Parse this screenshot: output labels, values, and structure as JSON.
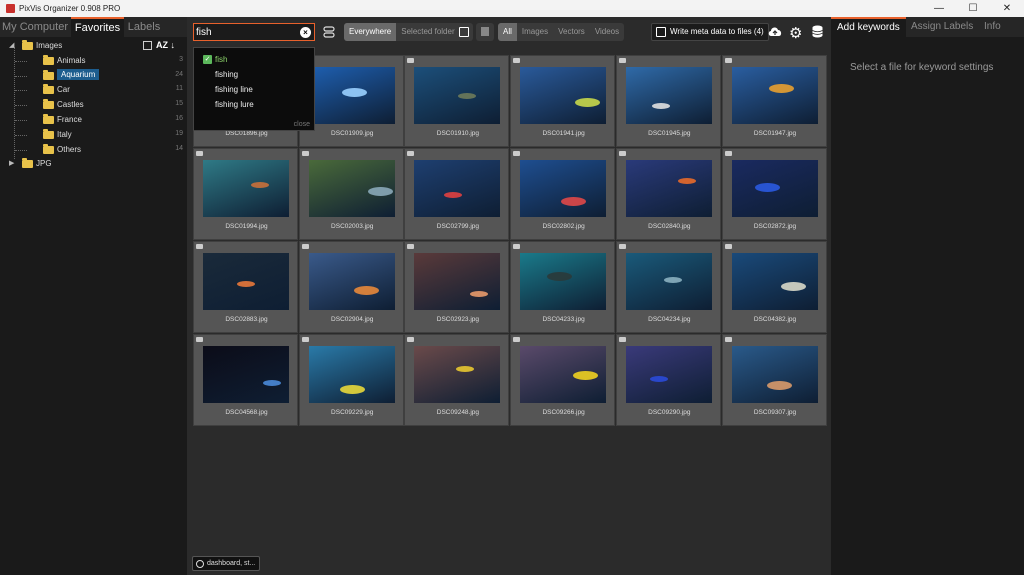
{
  "window": {
    "title": "PixVis Organizer 0.908 PRO",
    "minimize_glyph": "—",
    "maximize_glyph": "☐",
    "close_glyph": "✕"
  },
  "sidebar": {
    "tabs": [
      {
        "label": "My Computer",
        "active": false
      },
      {
        "label": "Favorites",
        "active": true
      },
      {
        "label": "Labels",
        "active": false
      }
    ],
    "sort_label": "AZ ↓",
    "tree": [
      {
        "label": "Images",
        "count": "",
        "expanded": true,
        "level": 0,
        "selected": false
      },
      {
        "label": "Animals",
        "count": "3",
        "level": 1,
        "selected": false
      },
      {
        "label": "Aquarium",
        "count": "24",
        "level": 1,
        "selected": true
      },
      {
        "label": "Car",
        "count": "11",
        "level": 1,
        "selected": false
      },
      {
        "label": "Castles",
        "count": "15",
        "level": 1,
        "selected": false
      },
      {
        "label": "France",
        "count": "16",
        "level": 1,
        "selected": false
      },
      {
        "label": "Italy",
        "count": "19",
        "level": 1,
        "selected": false
      },
      {
        "label": "Others",
        "count": "14",
        "level": 1,
        "selected": false
      },
      {
        "label": "JPG",
        "count": "",
        "expanded": false,
        "level": 0,
        "selected": false
      }
    ]
  },
  "toolbar": {
    "search_value": "fish",
    "scope_options": [
      {
        "label": "Everywhere",
        "active": true
      },
      {
        "label": "Selected folder",
        "active": false
      }
    ],
    "type_options": [
      {
        "label": "All",
        "active": true
      },
      {
        "label": "Images",
        "active": false
      },
      {
        "label": "Vectors",
        "active": false
      },
      {
        "label": "Videos",
        "active": false
      }
    ],
    "write_button_label": "Write meta data to files",
    "write_count": "(4)"
  },
  "suggestions": {
    "items": [
      {
        "label": "fish",
        "checked": true
      },
      {
        "label": "fishing",
        "checked": false
      },
      {
        "label": "fishing line",
        "checked": false
      },
      {
        "label": "fishing lure",
        "checked": false
      }
    ],
    "close_label": "close"
  },
  "files": [
    {
      "name": "DSC01896.jpg",
      "bg": "#2a4a7a",
      "accent": "#8ab8e8"
    },
    {
      "name": "DSC01909.jpg",
      "bg": "#1e5fb0",
      "accent": "#9ad0ff"
    },
    {
      "name": "DSC01910.jpg",
      "bg": "#1c4f7a",
      "accent": "#6d7a5a"
    },
    {
      "name": "DSC01941.jpg",
      "bg": "#2a5a9a",
      "accent": "#c8d84a"
    },
    {
      "name": "DSC01945.jpg",
      "bg": "#2f6aa8",
      "accent": "#e0e0e0"
    },
    {
      "name": "DSC01947.jpg",
      "bg": "#2a5ea0",
      "accent": "#e8a030"
    },
    {
      "name": "DSC01994.jpg",
      "bg": "#2f7a86",
      "accent": "#c8703a"
    },
    {
      "name": "DSC02003.jpg",
      "bg": "#4a6a3a",
      "accent": "#8aa8b8"
    },
    {
      "name": "DSC02799.jpg",
      "bg": "#1e3f70",
      "accent": "#e04040"
    },
    {
      "name": "DSC02802.jpg",
      "bg": "#1e4e90",
      "accent": "#e04848"
    },
    {
      "name": "DSC02840.jpg",
      "bg": "#2a3a7a",
      "accent": "#e86a2a"
    },
    {
      "name": "DSC02872.jpg",
      "bg": "#1a2a60",
      "accent": "#2a5ae0"
    },
    {
      "name": "DSC02883.jpg",
      "bg": "#1a2a3a",
      "accent": "#e8783a"
    },
    {
      "name": "DSC02904.jpg",
      "bg": "#3a5a8a",
      "accent": "#e8883a"
    },
    {
      "name": "DSC02923.jpg",
      "bg": "#5a3a3a",
      "accent": "#e89a6a"
    },
    {
      "name": "DSC04233.jpg",
      "bg": "#1a7a8a",
      "accent": "#2a3a3a"
    },
    {
      "name": "DSC04234.jpg",
      "bg": "#1a5a7a",
      "accent": "#8ab0c0"
    },
    {
      "name": "DSC04382.jpg",
      "bg": "#1a4a7a",
      "accent": "#d8d8c8"
    },
    {
      "name": "DSC04568.jpg",
      "bg": "#0c0c18",
      "accent": "#4a8ad8"
    },
    {
      "name": "DSC09229.jpg",
      "bg": "#2a7aa8",
      "accent": "#e8d83a"
    },
    {
      "name": "DSC09248.jpg",
      "bg": "#6a4a4a",
      "accent": "#e8c830"
    },
    {
      "name": "DSC09266.jpg",
      "bg": "#5a4a6a",
      "accent": "#f0d020"
    },
    {
      "name": "DSC09290.jpg",
      "bg": "#3a3a7a",
      "accent": "#2a4ad8"
    },
    {
      "name": "DSC09307.jpg",
      "bg": "#2a5a8a",
      "accent": "#d89a6a"
    }
  ],
  "right_panel": {
    "tabs": [
      {
        "label": "Add keywords",
        "active": true
      },
      {
        "label": "Assign Labels",
        "active": false
      },
      {
        "label": "Info",
        "active": false
      }
    ],
    "message": "Select a file for keyword settings"
  },
  "taskbar_chip": {
    "label": "dashboard, st..."
  }
}
